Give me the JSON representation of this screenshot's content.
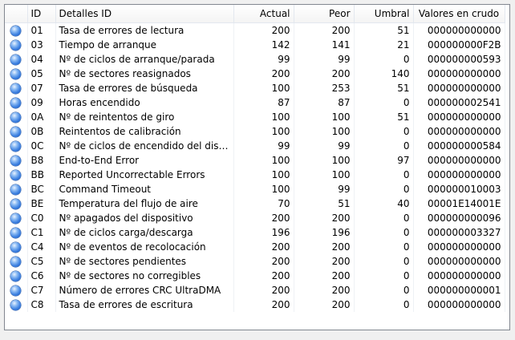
{
  "columns": {
    "id": "ID",
    "details": "Detalles ID",
    "actual": "Actual",
    "worst": "Peor",
    "threshold": "Umbral",
    "raw": "Valores en crudo"
  },
  "status_icon": "blue-orb-icon",
  "colors": {
    "orb": "#3b7fe0"
  },
  "rows": [
    {
      "id": "01",
      "name": "Tasa de errores de lectura",
      "actual": "200",
      "worst": "200",
      "threshold": "51",
      "raw": "000000000000"
    },
    {
      "id": "03",
      "name": "Tiempo de arranque",
      "actual": "142",
      "worst": "141",
      "threshold": "21",
      "raw": "000000000F2B"
    },
    {
      "id": "04",
      "name": "Nº de ciclos de arranque/parada",
      "actual": "99",
      "worst": "99",
      "threshold": "0",
      "raw": "000000000593"
    },
    {
      "id": "05",
      "name": "Nº de sectores reasignados",
      "actual": "200",
      "worst": "200",
      "threshold": "140",
      "raw": "000000000000"
    },
    {
      "id": "07",
      "name": "Tasa de errores de búsqueda",
      "actual": "100",
      "worst": "253",
      "threshold": "51",
      "raw": "000000000000"
    },
    {
      "id": "09",
      "name": "Horas encendido",
      "actual": "87",
      "worst": "87",
      "threshold": "0",
      "raw": "000000002541"
    },
    {
      "id": "0A",
      "name": "Nº de reintentos de giro",
      "actual": "100",
      "worst": "100",
      "threshold": "51",
      "raw": "000000000000"
    },
    {
      "id": "0B",
      "name": "Reintentos de calibración",
      "actual": "100",
      "worst": "100",
      "threshold": "0",
      "raw": "000000000000"
    },
    {
      "id": "0C",
      "name": "Nº de ciclos de encendido del disp...",
      "actual": "99",
      "worst": "99",
      "threshold": "0",
      "raw": "000000000584"
    },
    {
      "id": "B8",
      "name": "End-to-End Error",
      "actual": "100",
      "worst": "100",
      "threshold": "97",
      "raw": "000000000000"
    },
    {
      "id": "BB",
      "name": "Reported Uncorrectable Errors",
      "actual": "100",
      "worst": "100",
      "threshold": "0",
      "raw": "000000000000"
    },
    {
      "id": "BC",
      "name": "Command Timeout",
      "actual": "100",
      "worst": "99",
      "threshold": "0",
      "raw": "000000010003"
    },
    {
      "id": "BE",
      "name": "Temperatura del flujo de aire",
      "actual": "70",
      "worst": "51",
      "threshold": "40",
      "raw": "00001E14001E"
    },
    {
      "id": "C0",
      "name": "Nº apagados del dispositivo",
      "actual": "200",
      "worst": "200",
      "threshold": "0",
      "raw": "000000000096"
    },
    {
      "id": "C1",
      "name": "Nº de ciclos carga/descarga",
      "actual": "196",
      "worst": "196",
      "threshold": "0",
      "raw": "000000003327"
    },
    {
      "id": "C4",
      "name": "Nº de eventos de recolocación",
      "actual": "200",
      "worst": "200",
      "threshold": "0",
      "raw": "000000000000"
    },
    {
      "id": "C5",
      "name": "Nº de sectores pendientes",
      "actual": "200",
      "worst": "200",
      "threshold": "0",
      "raw": "000000000000"
    },
    {
      "id": "C6",
      "name": "Nº de sectores no corregibles",
      "actual": "200",
      "worst": "200",
      "threshold": "0",
      "raw": "000000000000"
    },
    {
      "id": "C7",
      "name": "Número de errores CRC UltraDMA",
      "actual": "200",
      "worst": "200",
      "threshold": "0",
      "raw": "000000000001"
    },
    {
      "id": "C8",
      "name": "Tasa de errores de escritura",
      "actual": "200",
      "worst": "200",
      "threshold": "0",
      "raw": "000000000000"
    }
  ]
}
